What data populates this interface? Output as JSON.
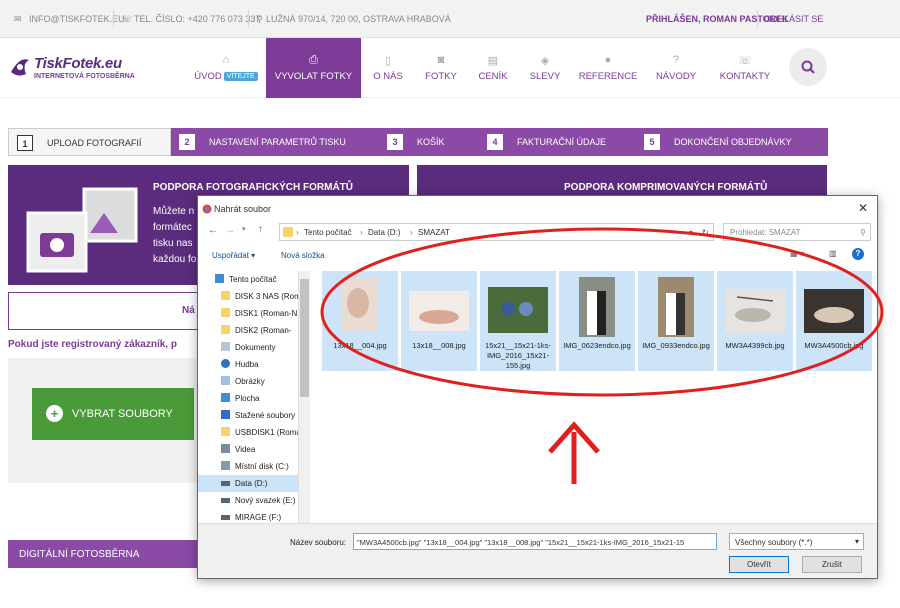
{
  "topbar": {
    "email": "INFO@TISKFOTEK.EU",
    "phone": "TEL. ČÍSLO: +420 776 073 337",
    "address": "LUŽNÁ 970/14, 720 00, OSTRAVA HRABOVÁ",
    "user": "PŘIHLÁŠEN, ROMAN PASTOREK",
    "logout": "ODHLÁSIT SE"
  },
  "logo": {
    "main": "TiskFotek.eu",
    "sub": "INTERNETOVÁ  FOTOSBĚRNA"
  },
  "nav": [
    {
      "label": "ÚVOD",
      "badge": "VÍTEJTE",
      "icon": "home-icon"
    },
    {
      "label": "VYVOLAT FOTKY",
      "icon": "print-icon",
      "active": true
    },
    {
      "label": "O NÁS",
      "icon": "phone-device-icon"
    },
    {
      "label": "FOTKY",
      "icon": "camera-icon"
    },
    {
      "label": "CENÍK",
      "icon": "table-icon"
    },
    {
      "label": "SLEVY",
      "icon": "tag-icon"
    },
    {
      "label": "REFERENCE",
      "icon": "comment-icon"
    },
    {
      "label": "NÁVODY",
      "icon": "question-icon"
    },
    {
      "label": "KONTAKTY",
      "icon": "phone-icon"
    }
  ],
  "steps": [
    {
      "num": "1",
      "label": "UPLOAD FOTOGRAFIÍ",
      "active": true
    },
    {
      "num": "2",
      "label": "NASTAVENÍ PARAMETRŮ TISKU"
    },
    {
      "num": "3",
      "label": "KOŠÍK"
    },
    {
      "num": "4",
      "label": "FAKTURAČNÍ ÚDAJE"
    },
    {
      "num": "5",
      "label": "DOKONČENÍ OBJEDNÁVKY"
    }
  ],
  "formats_box": {
    "title": "PODPORA FOTOGRAFICKÝCH FORMÁTŮ",
    "lines": [
      "Můžete n",
      "formátec",
      "tisku nas",
      "každou fo"
    ]
  },
  "compressed_box": {
    "title": "PODPORA KOMPRIMOVANÝCH FORMÁTŮ"
  },
  "outline_label": "Ná",
  "registered_text": "Pokud jste registrovaný zákazník, p",
  "select_button": "VYBRAT SOUBORY",
  "digital_label": "DIGITÁLNÍ FOTOSBĚRNA",
  "dialog": {
    "title": "Nahrát soubor",
    "path": [
      "Tento počítač",
      "Data (D:)",
      "SMAZAT"
    ],
    "search_placeholder": "Prohledat: SMAZAT",
    "organize": "Uspořádat",
    "new_folder": "Nová složka",
    "tree": [
      "Tento počítač",
      "DISK 3 NAS (Rom",
      "DISK1 (Roman-N",
      "DISK2 (Roman-",
      "Dokumenty",
      "Hudba",
      "Obrázky",
      "Plocha",
      "Stažené soubory",
      "USBDISK1 (Roma",
      "Videa",
      "Místní disk (C:)",
      "Data (D:)",
      "Nový svazek (E:)",
      "MIRAGE (F:)"
    ],
    "files": [
      "13x18__004.jpg",
      "13x18__008.jpg",
      "15x21__15x21-1ks-IMG_2016_15x21-155.jpg",
      "IMG_0623endco.jpg",
      "IMG_0933endco.jpg",
      "MW3A4399cb.jpg",
      "MW3A4500cb.jpg"
    ],
    "filename_label": "Název souboru:",
    "filename_value": "\"MW3A4500cb.jpg\" \"13x18__004.jpg\" \"13x18__008.jpg\" \"15x21__15x21-1ks-IMG_2016_15x21-15",
    "filetype": "Všechny soubory (*.*)",
    "open": "Otevřít",
    "cancel": "Zrušit"
  },
  "colors": {
    "brand": "#7b3b96",
    "brand_dark": "#5b2c7d",
    "green": "#4a9a3a",
    "annotation": "#e0201c",
    "selection": "#cde3f7"
  }
}
